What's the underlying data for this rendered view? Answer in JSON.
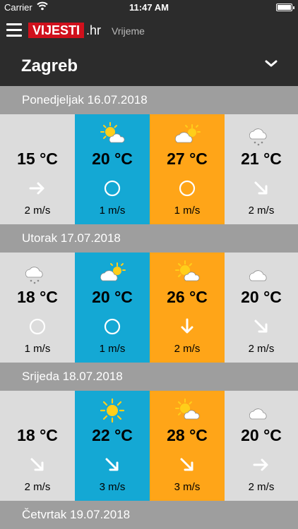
{
  "status": {
    "carrier": "Carrier",
    "time": "11:47 AM"
  },
  "nav": {
    "logo": "VIJESTI",
    "logo_suffix": ".hr",
    "section": "Vrijeme"
  },
  "city": "Zagreb",
  "colors": {
    "night": "#dcdcdc",
    "morning": "#14a8d4",
    "day": "#ffa518",
    "evening": "#dcdcdc",
    "header_bg": "#9e9e9e",
    "bar_bg": "#2c2c2c",
    "brand_red": "#d0101c"
  },
  "days": [
    {
      "label": "Ponedjeljak 16.07.2018",
      "slots": [
        {
          "icon": "moon-icon",
          "temp": "15 °C",
          "direction": "arrow-right-icon",
          "wind": "2 m/s"
        },
        {
          "icon": "sun-cloud-icon",
          "temp": "20 °C",
          "direction": "calm-circle-icon",
          "wind": "1 m/s"
        },
        {
          "icon": "cloud-sun-icon",
          "temp": "27 °C",
          "direction": "calm-circle-icon",
          "wind": "1 m/s"
        },
        {
          "icon": "moon-cloud-rain-icon",
          "temp": "21 °C",
          "direction": "arrow-down-right-icon",
          "wind": "2 m/s"
        }
      ]
    },
    {
      "label": "Utorak 17.07.2018",
      "slots": [
        {
          "icon": "moon-cloud-rain-icon",
          "temp": "18 °C",
          "direction": "calm-circle-icon",
          "wind": "1 m/s"
        },
        {
          "icon": "cloud-sun-icon",
          "temp": "20 °C",
          "direction": "calm-circle-icon",
          "wind": "1 m/s"
        },
        {
          "icon": "sun-cloud-icon",
          "temp": "26 °C",
          "direction": "arrow-down-icon",
          "wind": "2 m/s"
        },
        {
          "icon": "moon-cloud-icon",
          "temp": "20 °C",
          "direction": "arrow-down-right-icon",
          "wind": "2 m/s"
        }
      ]
    },
    {
      "label": "Srijeda 18.07.2018",
      "slots": [
        {
          "icon": "moon-icon",
          "temp": "18 °C",
          "direction": "arrow-down-right-icon",
          "wind": "2 m/s"
        },
        {
          "icon": "sun-icon",
          "temp": "22 °C",
          "direction": "arrow-down-right-icon",
          "wind": "3 m/s"
        },
        {
          "icon": "sun-cloud-icon",
          "temp": "28 °C",
          "direction": "arrow-down-right-icon",
          "wind": "3 m/s"
        },
        {
          "icon": "moon-cloud-icon",
          "temp": "20 °C",
          "direction": "arrow-right-icon",
          "wind": "2 m/s"
        }
      ]
    },
    {
      "label": "Četvrtak 19.07.2018",
      "slots": []
    }
  ]
}
